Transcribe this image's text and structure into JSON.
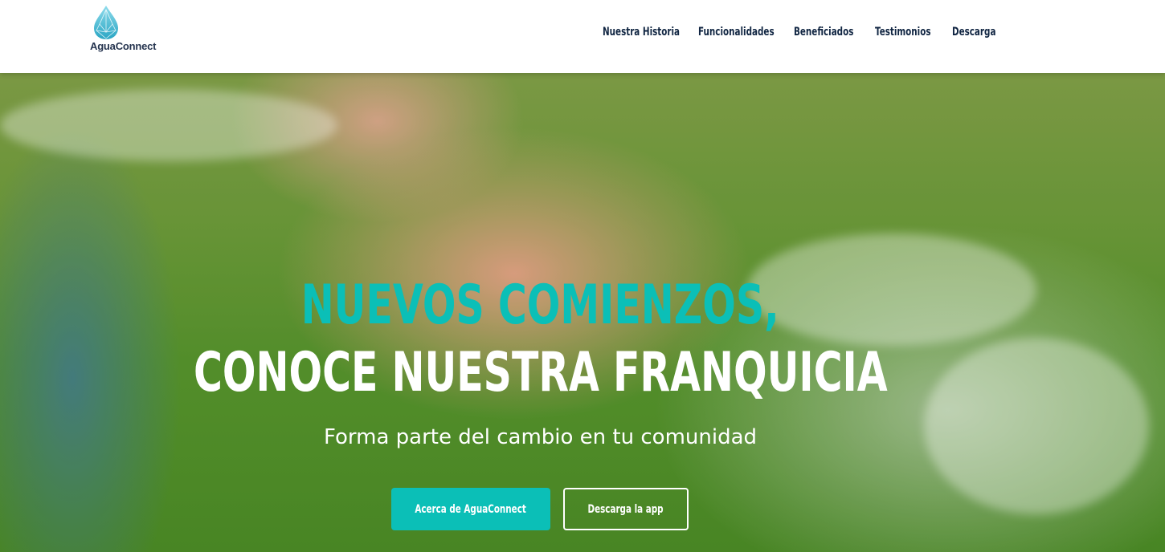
{
  "brand": {
    "name": "AguaConnect",
    "icon": "water-drop-icon",
    "colors": {
      "accent": "#0bbfb7",
      "navy": "#102542",
      "drop": "#5fc7dc"
    }
  },
  "nav": {
    "items": [
      {
        "label": "Nuestra Historia"
      },
      {
        "label": "Funcionalidades"
      },
      {
        "label": "Beneficiados"
      },
      {
        "label": "Testimonios"
      },
      {
        "label": "Descarga"
      }
    ]
  },
  "hero": {
    "headline_line1": "NUEVOS COMIENZOS,",
    "headline_line2": "CONOCE NUESTRA FRANQUICIA",
    "subtitle": "Forma parte del cambio en tu comunidad",
    "primary_button": "Acerca de AguaConnect",
    "secondary_button": "Descarga la app"
  }
}
